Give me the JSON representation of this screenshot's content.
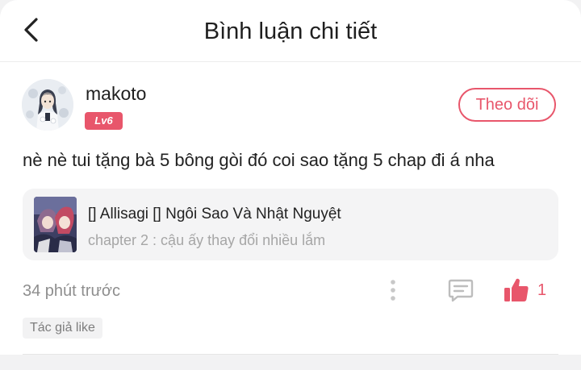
{
  "header": {
    "title": "Bình luận chi tiết",
    "back_icon": "chevron-left-icon"
  },
  "comment": {
    "user": {
      "name": "makoto",
      "level": "Lv6",
      "avatar_icon": "user-avatar-anime"
    },
    "follow_label": "Theo dõi",
    "text": "nè nè tui tặng bà 5 bông gòi đó coi sao tặng 5 chap đi á nha",
    "manga": {
      "title": "[] Allisagi [] Ngôi Sao Và Nhật Nguyệt",
      "chapter": "chapter 2 : cậu ấy thay đổi nhiều lắm",
      "cover_icon": "manga-cover-thumbnail"
    },
    "time": "34 phút trước",
    "like_count": "1",
    "author_like_tag": "Tác giả like",
    "icons": {
      "more": "more-vertical-icon",
      "reply": "comment-icon",
      "like": "thumbs-up-icon"
    }
  },
  "colors": {
    "accent": "#e8566b",
    "muted_text": "#8e8e8e",
    "card_bg": "#f4f4f5"
  }
}
